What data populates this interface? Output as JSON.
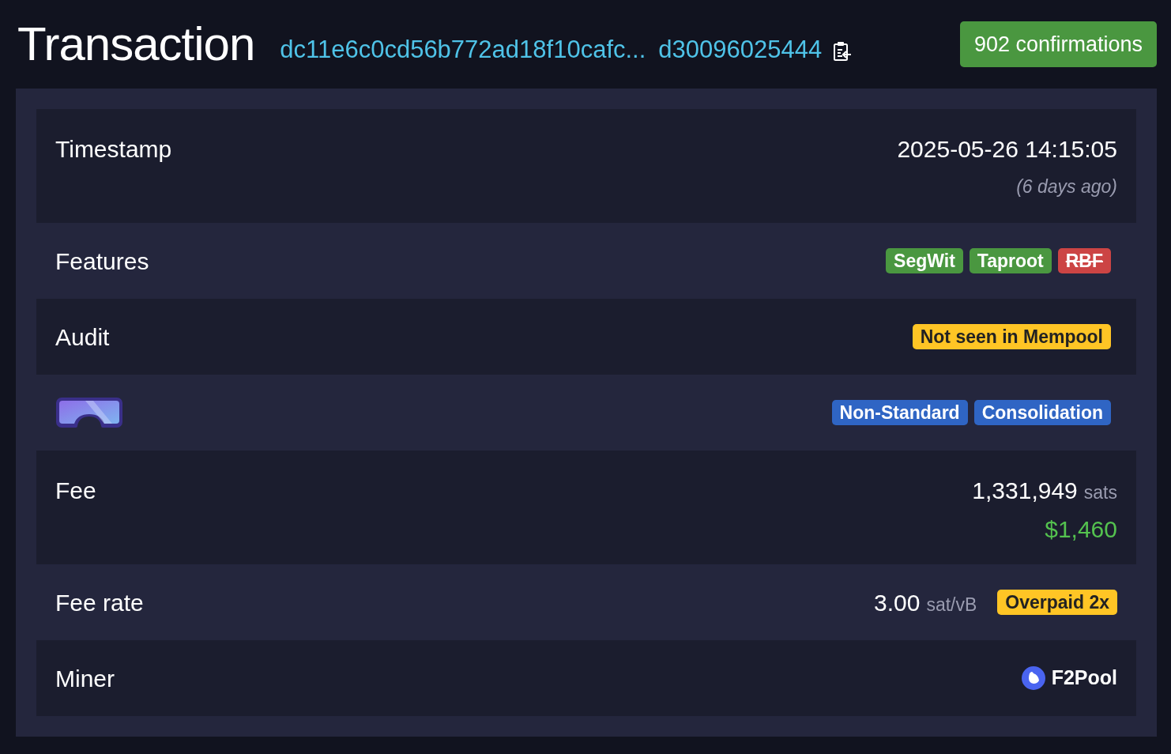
{
  "header": {
    "title": "Transaction",
    "txid_start": "dc11e6c0cd56b772ad18f10cafc...",
    "txid_end": "d30096025444",
    "confirmations": "902 confirmations"
  },
  "rows": [
    {
      "kind": "timestamp",
      "label": "Timestamp",
      "value": "2025-05-26 14:15:05",
      "note": "(6 days ago)"
    },
    {
      "kind": "tags",
      "label": "Features",
      "tags": [
        {
          "text": "SegWit",
          "kind": "success",
          "disabled": false
        },
        {
          "text": "Taproot",
          "kind": "success",
          "disabled": false
        },
        {
          "text": "RBF",
          "kind": "danger",
          "disabled": true
        }
      ]
    },
    {
      "kind": "tags",
      "label": "Audit",
      "tags": [
        {
          "text": "Not seen in Mempool",
          "kind": "warning",
          "disabled": false
        }
      ]
    },
    {
      "kind": "flags",
      "tags": [
        {
          "text": "Non-Standard",
          "kind": "primary",
          "disabled": false
        },
        {
          "text": "Consolidation",
          "kind": "primary",
          "disabled": false
        }
      ]
    },
    {
      "kind": "fee",
      "label": "Fee",
      "amount": "1,331,949",
      "unit": "sats",
      "fiat": "$1,460"
    },
    {
      "kind": "rate",
      "label": "Fee rate",
      "amount": "3.00",
      "unit": "sat/vB",
      "tags": [
        {
          "text": "Overpaid 2x",
          "kind": "warning",
          "disabled": false
        }
      ]
    },
    {
      "kind": "miner",
      "label": "Miner",
      "pool": "F2Pool"
    }
  ]
}
